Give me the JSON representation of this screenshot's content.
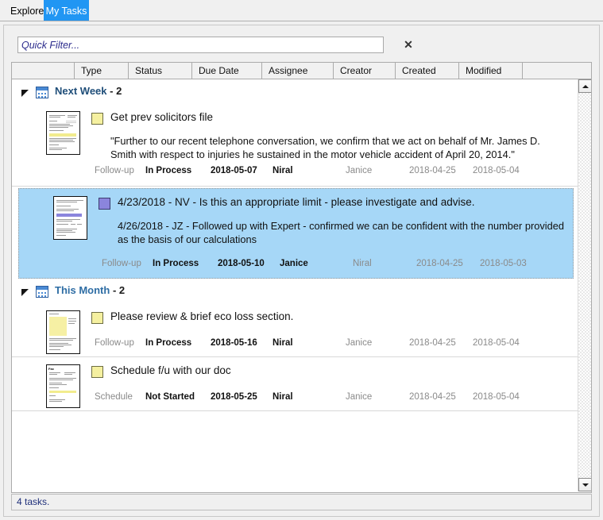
{
  "tabs": [
    {
      "label": "Explorer",
      "active": false
    },
    {
      "label": "My Tasks",
      "active": true
    }
  ],
  "filter": {
    "placeholder": "Quick Filter...",
    "value": "",
    "clear_label": "✕"
  },
  "columns": [
    {
      "label": ""
    },
    {
      "label": "Type"
    },
    {
      "label": "Status"
    },
    {
      "label": "Due Date"
    },
    {
      "label": "Assignee"
    },
    {
      "label": "Creator"
    },
    {
      "label": "Created"
    },
    {
      "label": "Modified"
    },
    {
      "label": ""
    }
  ],
  "groups": [
    {
      "name": "Next Week",
      "count": "- 2",
      "icon": "calendar-icon",
      "collapse_icon": "expanded-triangle-icon",
      "tasks": [
        {
          "swatch_color": "#f5f0a0",
          "title": "Get prev solicitors file",
          "body": "\"Further to our recent telephone conversation, we confirm that we act on behalf of Mr. James D. Smith with respect to injuries he sustained in the motor vehicle accident of April 20, 2014.\"",
          "type": "Follow-up",
          "status": "In Process",
          "due_date": "2018-05-07",
          "assignee": "Niral",
          "creator": "Janice",
          "created": "2018-04-25",
          "modified": "2018-05-04",
          "selected": false,
          "thumb": "letter"
        },
        {
          "swatch_color": "#8b85dd",
          "title": "4/23/2018 - NV - Is this an appropriate limit - please investigate and advise.",
          "body": "4/26/2018 - JZ - Followed up with Expert - confirmed we can be confident with the number provided as the basis of our calculations",
          "type": "Follow-up",
          "status": "In Process",
          "due_date": "2018-05-10",
          "assignee": "Janice",
          "creator": "Niral",
          "created": "2018-04-25",
          "modified": "2018-05-03",
          "selected": true,
          "thumb": "purple-letter"
        }
      ]
    },
    {
      "name": "This Month",
      "count": "- 2",
      "icon": "calendar-icon",
      "collapse_icon": "expanded-triangle-icon",
      "tasks": [
        {
          "swatch_color": "#f5f0a0",
          "title": "Please review & brief eco loss section.",
          "body": "",
          "type": "Follow-up",
          "status": "In Process",
          "due_date": "2018-05-16",
          "assignee": "Niral",
          "creator": "Janice",
          "created": "2018-04-25",
          "modified": "2018-05-04",
          "selected": false,
          "thumb": "sticky"
        },
        {
          "swatch_color": "#f5f0a0",
          "title": "Schedule f/u with our doc",
          "body": "",
          "type": "Schedule",
          "status": "Not Started",
          "due_date": "2018-05-25",
          "assignee": "Niral",
          "creator": "Janice",
          "created": "2018-04-25",
          "modified": "2018-05-04",
          "selected": false,
          "thumb": "fax"
        }
      ]
    }
  ],
  "scrollbar": {
    "up_icon": "scroll-up-arrow-icon",
    "down_icon": "scroll-down-arrow-icon"
  },
  "statusbar": {
    "text": "4 tasks."
  },
  "colors": {
    "accent": "#2196f3",
    "selection": "#a6d7f7",
    "group_label": "#1f4e79",
    "status_text": "#1f2f7a"
  }
}
